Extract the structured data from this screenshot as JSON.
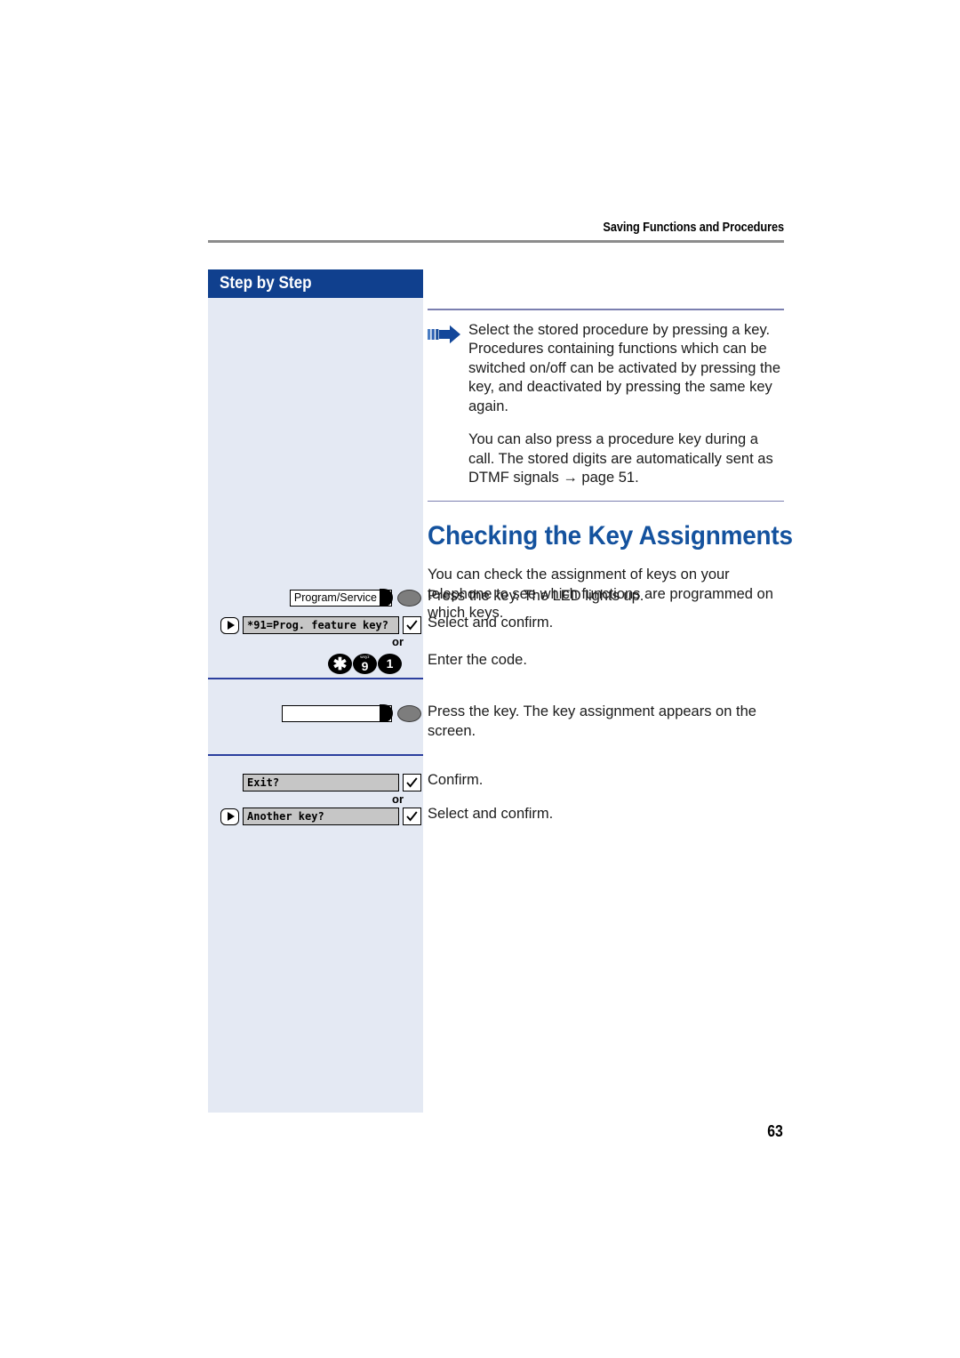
{
  "header": {
    "running_title": "Saving Functions and Procedures"
  },
  "sidebar": {
    "banner_label": "Step by Step",
    "rows": [
      {
        "type": "hardkey",
        "name": "program-service-key",
        "label": "Program/Service",
        "led": true
      },
      {
        "type": "displayline",
        "name": "prog-feature-key-option",
        "label": "*91=Prog. feature key?",
        "has_nav_icon": true,
        "has_ok": true
      },
      {
        "type": "keypad",
        "name": "code-keypad",
        "keys": [
          {
            "digit": "✱",
            "letters": ""
          },
          {
            "digit": "9",
            "letters": "wxyz"
          },
          {
            "digit": "1",
            "letters": ""
          }
        ]
      },
      {
        "type": "hardkey",
        "name": "blank-feature-key",
        "label": "",
        "led": true
      },
      {
        "type": "displayline",
        "name": "exit-option",
        "label": "Exit?",
        "has_nav_icon": false,
        "has_ok": true
      },
      {
        "type": "displayline",
        "name": "another-key-option",
        "label": "Another key?",
        "has_nav_icon": true,
        "has_ok": true
      }
    ],
    "or_labels": [
      "or",
      "or"
    ]
  },
  "content": {
    "note": {
      "icon": "blue-arrow-icon",
      "paragraphs": [
        "Select the stored procedure by pressing a key. Procedures containing functions which can be switched on/off can be activated by pressing the key, and deactivated by pressing the same key again.",
        "You can also press a procedure key during a call. The stored digits are automatically sent as DTMF signals → page 51."
      ]
    },
    "section_title": "Checking the Key Assignments",
    "intro": "You can check the assignment of keys on your telephone to see which functions are programmed on which keys.",
    "captions": [
      "Press the key. The LED lights up.",
      "Select and confirm.",
      "Enter the code.",
      "Press the key. The key assignment appears on the screen.",
      "Confirm.",
      "Select and confirm."
    ]
  },
  "footer": {
    "page_number": "63"
  },
  "colors": {
    "banner_blue": "#10408e",
    "title_blue": "#14529e",
    "sidebar_bg": "#e4e9f3",
    "divider_blue": "#2b3f9e",
    "rule_gray": "#8c8c8c"
  }
}
